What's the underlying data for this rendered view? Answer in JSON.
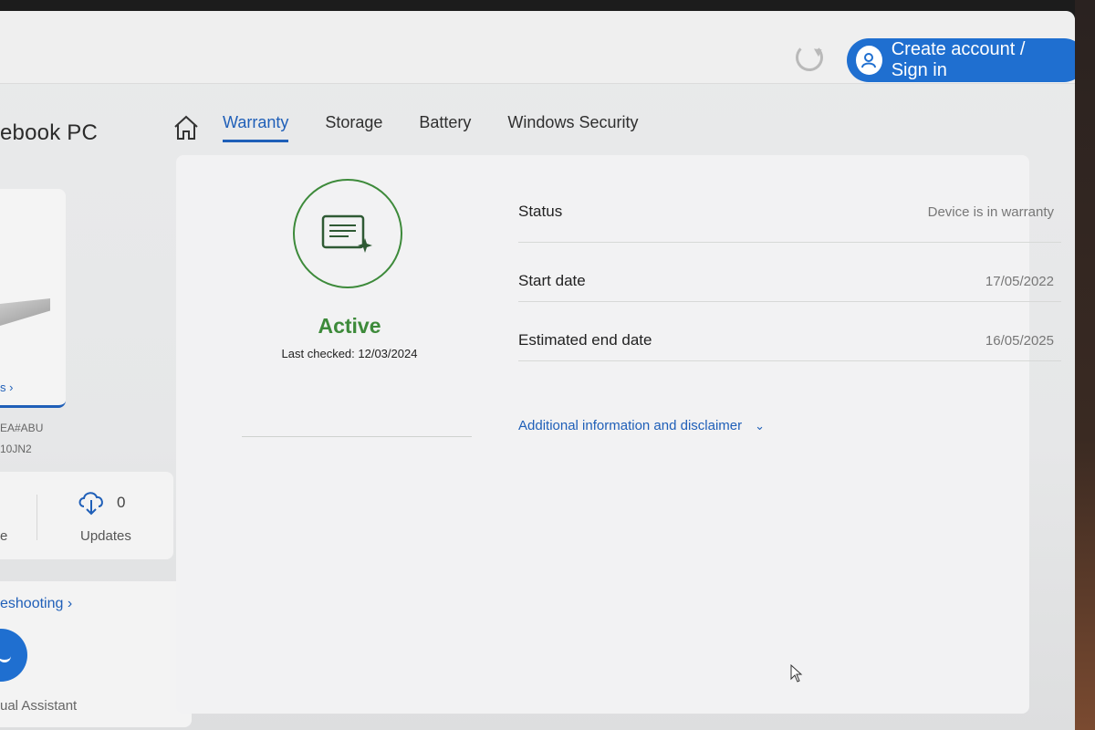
{
  "header": {
    "signin_label": "Create account / Sign in",
    "product_title": "ebook PC"
  },
  "tabs": [
    {
      "label": "Warranty",
      "active": true
    },
    {
      "label": "Storage",
      "active": false
    },
    {
      "label": "Battery",
      "active": false
    },
    {
      "label": "Windows Security",
      "active": false
    }
  ],
  "sidebar": {
    "device_link": "s ›",
    "sku_line1": "EA#ABU",
    "sku_line2": "10JN2",
    "left_trunc": "e",
    "updates_count": "0",
    "updates_label": "Updates",
    "troubleshooting_link": "eshooting ›",
    "assistant_label": "ual Assistant"
  },
  "warranty": {
    "state": "Active",
    "last_checked": "Last checked: 12/03/2024",
    "rows": [
      {
        "key": "Status",
        "value": "Device is in warranty"
      },
      {
        "key": "Start date",
        "value": "17/05/2022"
      },
      {
        "key": "Estimated end date",
        "value": "16/05/2025"
      }
    ],
    "additional_info": "Additional information and disclaimer"
  },
  "colors": {
    "accent_blue": "#1f5fb8",
    "active_green": "#3d8a3a"
  }
}
